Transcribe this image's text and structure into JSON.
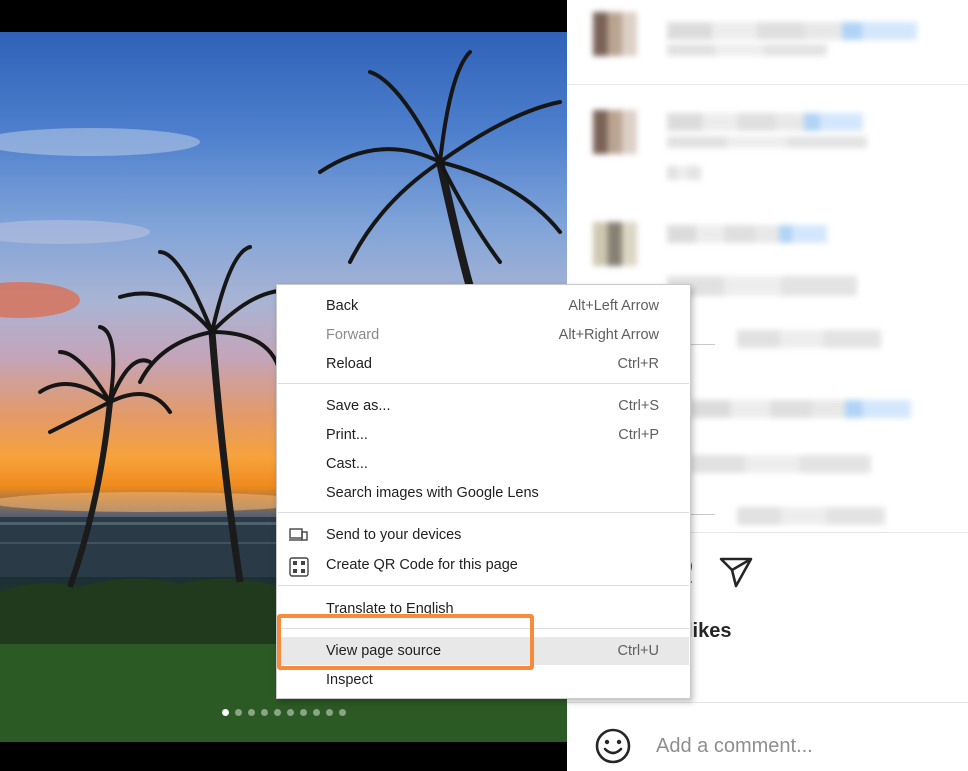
{
  "photo": {
    "carousel": {
      "count": 10,
      "active_index": 0
    }
  },
  "post": {
    "likes_label": "likes",
    "comment_placeholder": "Add a comment..."
  },
  "context_menu": {
    "items": [
      {
        "label": "Back",
        "shortcut": "Alt+Left Arrow"
      },
      {
        "label": "Forward",
        "shortcut": "Alt+Right Arrow",
        "disabled": true
      },
      {
        "label": "Reload",
        "shortcut": "Ctrl+R"
      },
      {
        "label": "Save as...",
        "shortcut": "Ctrl+S"
      },
      {
        "label": "Print...",
        "shortcut": "Ctrl+P"
      },
      {
        "label": "Cast...",
        "shortcut": ""
      },
      {
        "label": "Search images with Google Lens",
        "shortcut": ""
      },
      {
        "label": "Send to your devices",
        "shortcut": "",
        "icon": "devices-icon"
      },
      {
        "label": "Create QR Code for this page",
        "shortcut": "",
        "icon": "qr-code-icon"
      },
      {
        "label": "Translate to English",
        "shortcut": ""
      },
      {
        "label": "View page source",
        "shortcut": "Ctrl+U",
        "highlighted": true
      },
      {
        "label": "Inspect",
        "shortcut": ""
      }
    ]
  },
  "colors": {
    "callout": "#f68b3c",
    "menu_highlight": "#e8e8e8",
    "disabled_text": "#8a8a8a"
  }
}
